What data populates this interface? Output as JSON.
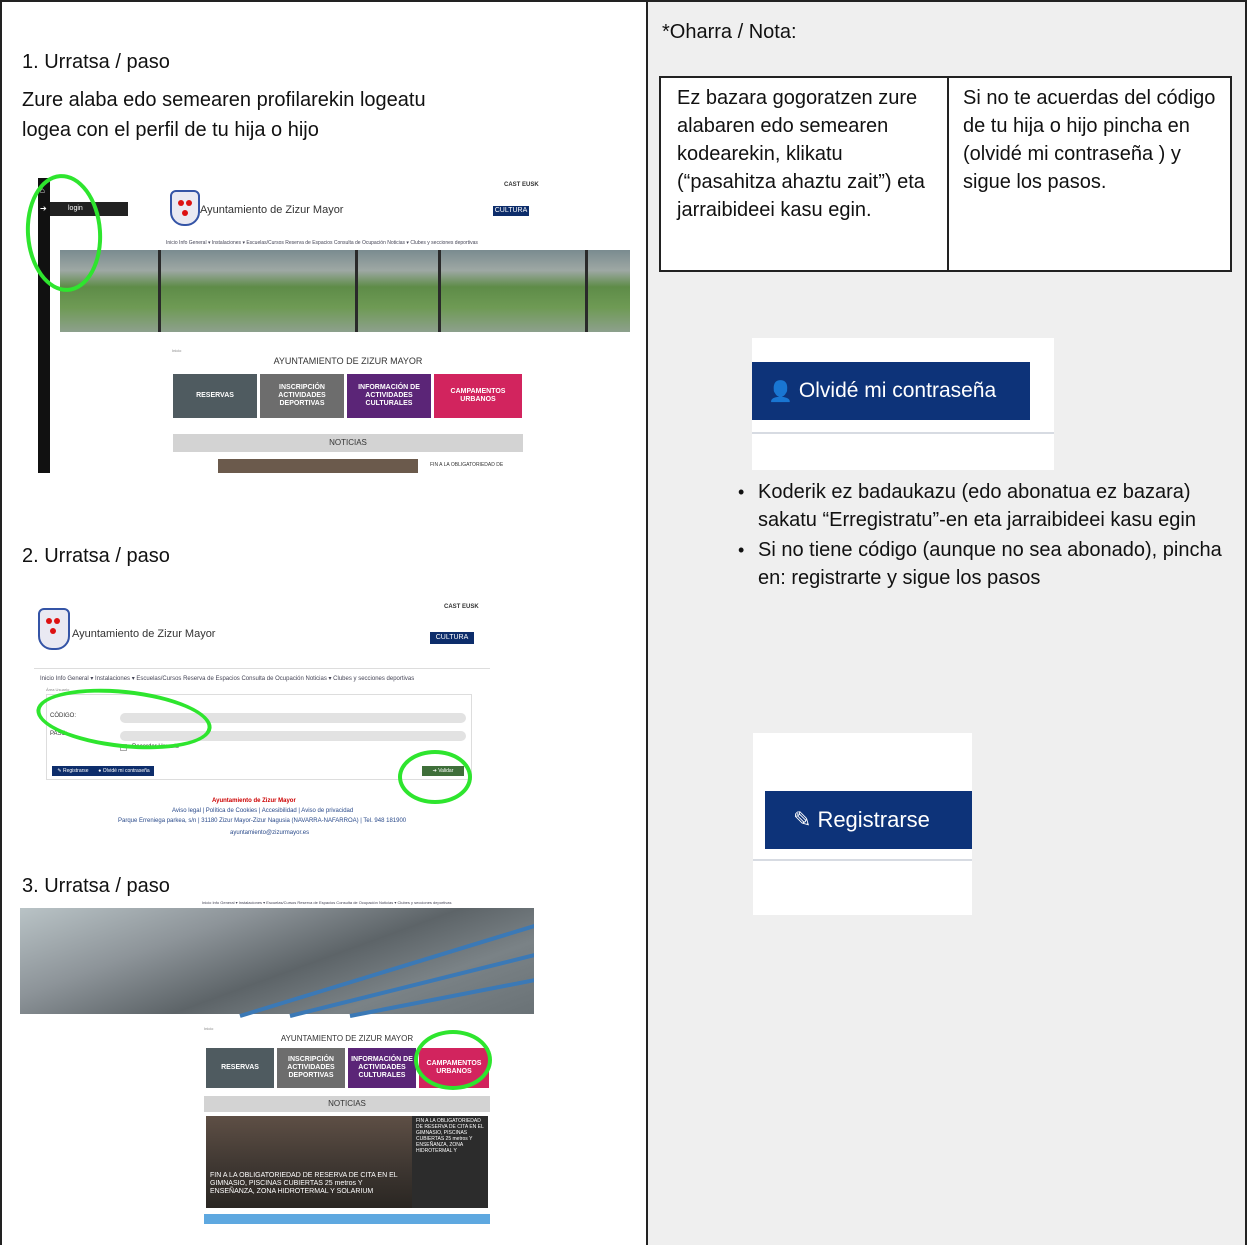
{
  "left": {
    "step1": {
      "title": "1. Urratsa / paso",
      "line_eu": "Zure alaba edo semearen profilarekin logeatu",
      "line_es": "logea con el perfil de tu hija o hijo"
    },
    "step2": {
      "title": "2. Urratsa / paso"
    },
    "step3": {
      "title": "3. Urratsa / paso"
    }
  },
  "screenshot1": {
    "menu_login": "login",
    "lang": "CAST EUSK",
    "site_name": "Ayuntamiento de Zizur Mayor",
    "cultura_btn": "CULTURA",
    "nav": "Inicio   Info General ▾   Instalaciones ▾   Escuelas/Cursos   Reserva de Espacios   Consulta de Ocupación   Noticias ▾   Clubes y secciones deportivas",
    "breadcrumb": "Inicio",
    "heading": "AYUNTAMIENTO DE ZIZUR MAYOR",
    "tiles": [
      "RESERVAS",
      "INSCRIPCIÓN ACTIVIDADES DEPORTIVAS",
      "INFORMACIÓN DE ACTIVIDADES CULTURALES",
      "CAMPAMENTOS URBANOS"
    ],
    "noticias": "NOTICIAS",
    "news_side": "FIN A LA OBLIGATORIEDAD DE"
  },
  "screenshot2": {
    "lang": "CAST EUSK",
    "site_name": "Ayuntamiento de Zizur Mayor",
    "cultura_btn": "CULTURA",
    "nav": "Inicio   Info General ▾   Instalaciones ▾   Escuelas/Cursos   Reserva de Espacios   Consulta de Ocupación   Noticias ▾   Clubes y secciones deportivas",
    "breadcrumb": "Área Usuario",
    "codigo_label": "CÓDIGO:",
    "pass_label": "PASS:",
    "remember": "Recordar Usuario",
    "register_btn": "Registrarse",
    "forgot_btn": "Olvidé mi contraseña",
    "validate_btn": "Validar",
    "footer_title": "Ayuntamiento de Zizur Mayor",
    "footer_links": "Aviso legal  |  Política de Cookies  |  Accesibilidad  |  Aviso de privacidad",
    "footer_address": "Parque Erreniega parkea, s/n  |  31180 Zizur Mayor-Zizur Nagusia (NAVARRA-NAFARROA)  |  Tel. 948 181900",
    "footer_email": "ayuntamiento@zizurmayor.es"
  },
  "screenshot3": {
    "nav": "Inicio   Info General ▾   Instalaciones ▾   Escuelas/Cursos   Reserva de Espacios   Consulta de Ocupación   Noticias ▾   Clubes y secciones deportivas",
    "breadcrumb": "Inicio",
    "heading": "AYUNTAMIENTO DE ZIZUR MAYOR",
    "tiles": [
      "RESERVAS",
      "INSCRIPCIÓN ACTIVIDADES DEPORTIVAS",
      "INFORMACIÓN DE ACTIVIDADES CULTURALES",
      "CAMPAMENTOS URBANOS"
    ],
    "noticias": "NOTICIAS",
    "news_caption": "FIN A LA OBLIGATORIEDAD DE RESERVA DE CITA EN EL GIMNASIO, PISCINAS CUBIERTAS 25 metros Y ENSEÑANZA, ZONA HIDROTERMAL Y SOLARIUM",
    "news_side": "FIN A LA OBLIGATORIEDAD DE RESERVA DE CITA EN EL GIMNASIO, PISCINAS CUBIERTAS 25 metros Y ENSEÑANZA, ZONA HIDROTERMAL Y"
  },
  "right": {
    "nota_title": "*Oharra / Nota:",
    "nota_eu": "Ez bazara gogoratzen zure alabaren edo semearen kodearekin, klikatu (“pasahitza ahaztu zait”) eta jarraibideei kasu egin.",
    "nota_es": "Si no te acuerdas del código de tu hija o hijo pincha en (olvidé mi contraseña ) y sigue los pasos.",
    "forgot_button": "Olvidé mi contraseña",
    "bullets": [
      "Koderik ez badaukazu (edo abonatua ez bazara) sakatu “Erregistratu”-en eta jarraibideei kasu egin",
      "Si no tiene código (aunque no sea abonado), pincha en:  registrarte y sigue los pasos"
    ],
    "register_button": "Registrarse"
  },
  "colors": {
    "navy": "#0d3379",
    "highlight_green": "#2ee52e",
    "panel_gray": "#efefef"
  }
}
